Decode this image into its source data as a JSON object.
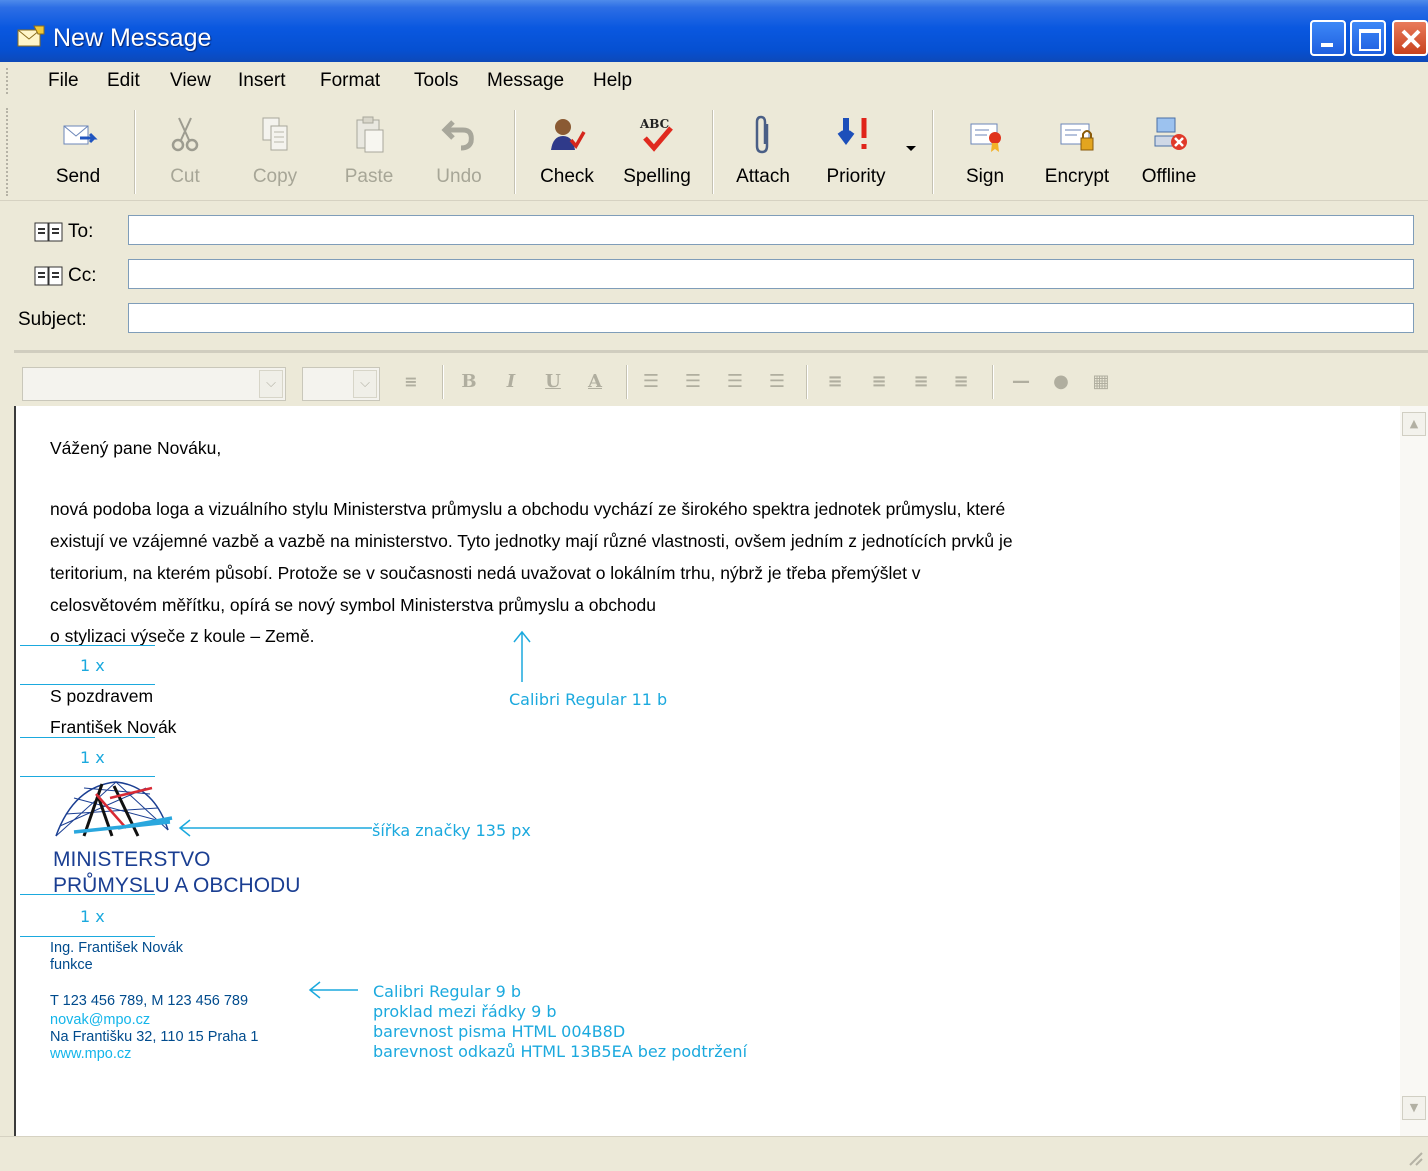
{
  "window": {
    "title": "New Message"
  },
  "menu": [
    "File",
    "Edit",
    "View",
    "Insert",
    "Format",
    "Tools",
    "Message",
    "Help"
  ],
  "toolbar": {
    "send": "Send",
    "cut": "Cut",
    "copy": "Copy",
    "paste": "Paste",
    "undo": "Undo",
    "check": "Check",
    "spelling": "Spelling",
    "spelling_icon_text": "ABC",
    "attach": "Attach",
    "priority": "Priority",
    "sign": "Sign",
    "encrypt": "Encrypt",
    "offline": "Offline"
  },
  "header": {
    "to_label": "To:",
    "cc_label": "Cc:",
    "subject_label": "Subject:",
    "to_value": "",
    "cc_value": "",
    "subject_value": ""
  },
  "message": {
    "greeting": "Vážený pane Nováku,",
    "paragraph_lines": [
      "nová podoba loga a vizuálního stylu Ministerstva průmyslu a obchodu vychází ze širokého spektra jednotek průmyslu, které",
      "existují ve vzájemné vazbě a vazbě na ministerstvo. Tyto jednotky mají různé vlastnosti, ovšem jedním z jednotících prvků je",
      "teritorium, na kterém působí. Protože se v současnosti nedá uvažovat o lokálním trhu, nýbrž je třeba přemýšlet v",
      "celosvětovém měřítku, opírá se nový symbol Ministerstva průmyslu a obchodu",
      "o stylizaci výseče z koule – Země."
    ],
    "closing": "S pozdravem",
    "name": "František Novák"
  },
  "logo": {
    "line1": "MINISTERSTVO",
    "line2": "PRŮMYSLU A OBCHODU"
  },
  "signature": {
    "name": "Ing. František Novák",
    "function": "funkce",
    "phone": "T 123 456 789, M 123 456 789",
    "email": "novak@mpo.cz",
    "address": "Na Františku 32, 110 15  Praha 1",
    "web": "www.mpo.cz"
  },
  "annotations": {
    "spacing": "1 x",
    "body_font": "Calibri Regular 11 b",
    "logo_width": "šířka značky 135 px",
    "sig_lines": [
      "Calibri Regular 9 b",
      "proklad mezi řádky 9 b",
      "barevnost pisma HTML 004B8D",
      "barevnost odkazů HTML 13B5EA bez podtržení"
    ]
  },
  "colors": {
    "title_bar": "#0a58e0",
    "annotation": "#1ba9de",
    "signature_text": "#004B8D",
    "signature_link": "#13B5EA",
    "logo_blue": "#1a3e92"
  }
}
